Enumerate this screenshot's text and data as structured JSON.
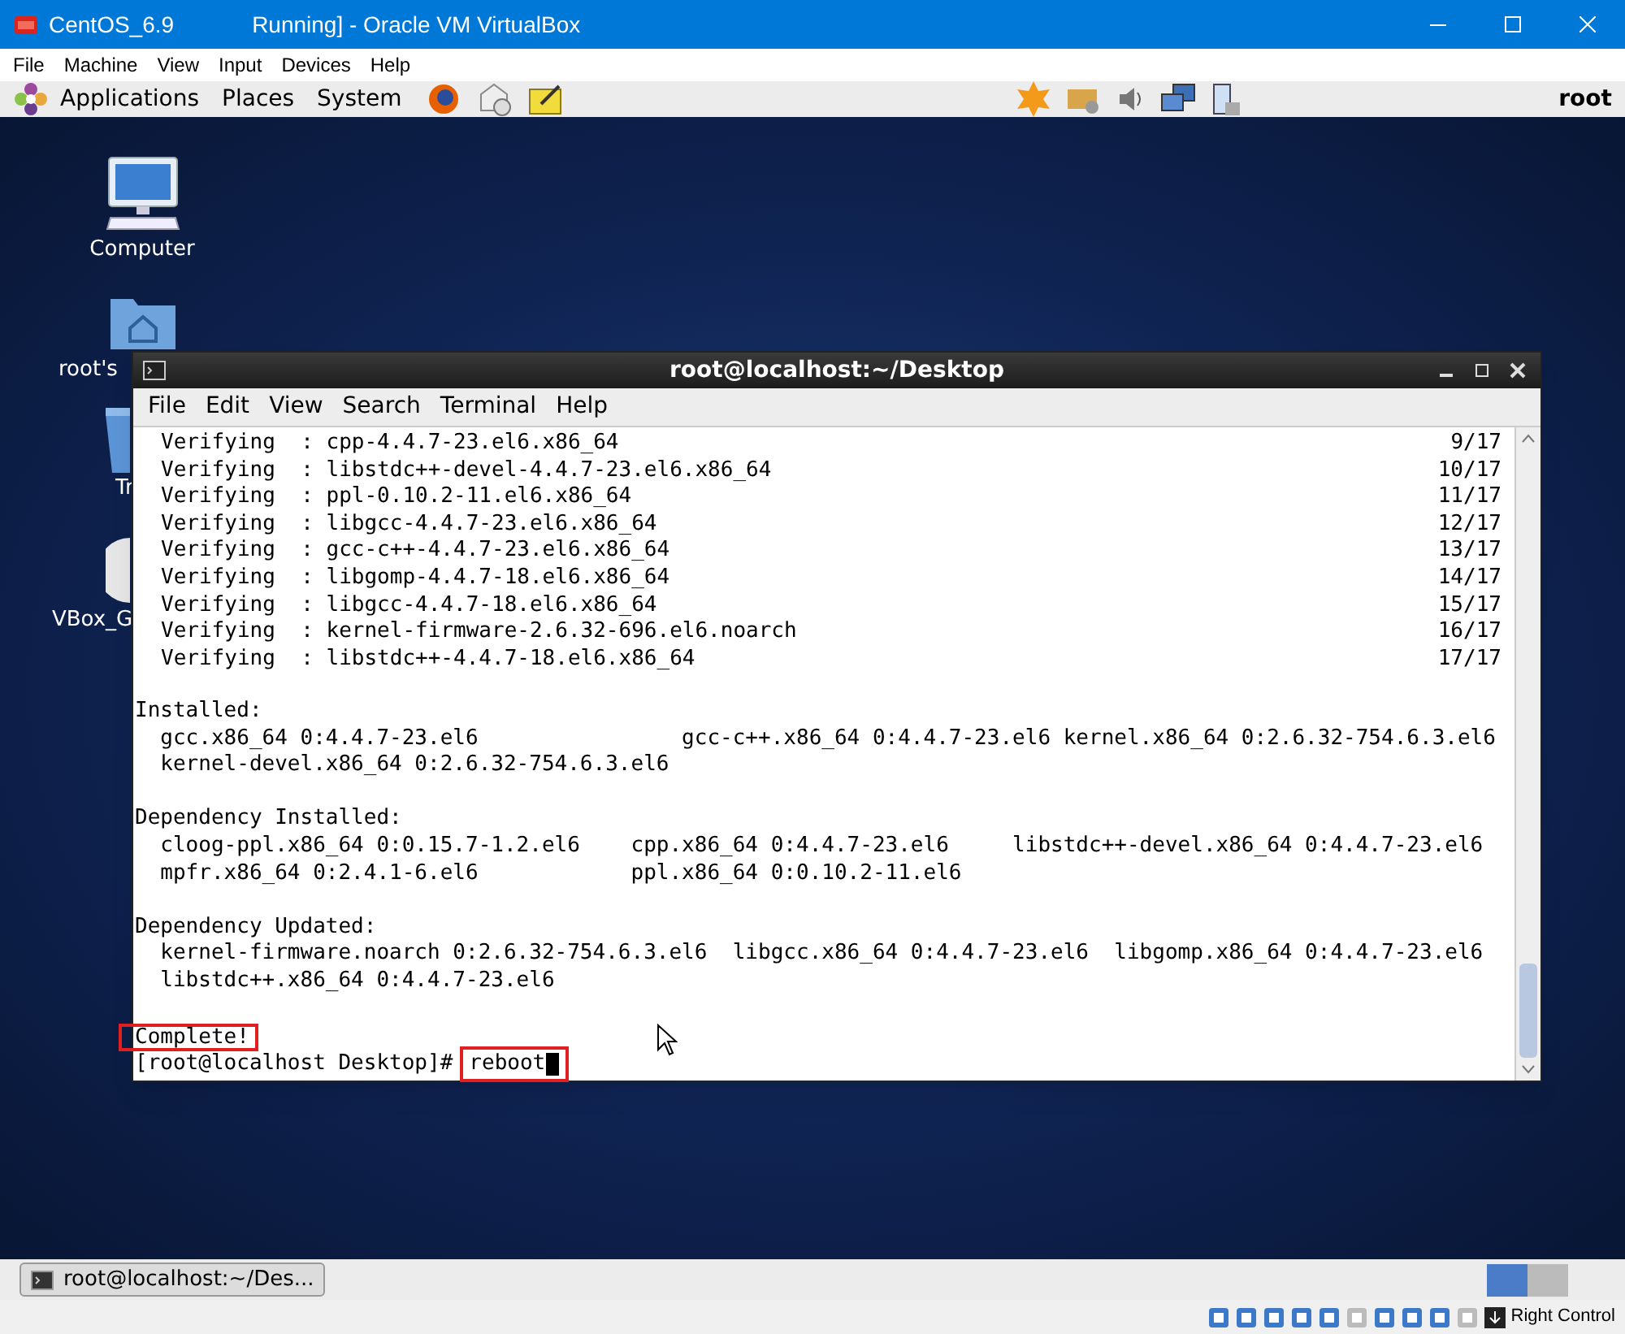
{
  "host_window": {
    "title_start": "CentOS_6.9",
    "title_end": "Running] - Oracle VM VirtualBox",
    "menu": [
      "File",
      "Machine",
      "View",
      "Input",
      "Devices",
      "Help"
    ]
  },
  "guest_panel": {
    "menus": [
      "Applications",
      "Places",
      "System"
    ],
    "user": "root"
  },
  "desktop_icons": [
    {
      "kind": "computer",
      "label": "Computer"
    },
    {
      "kind": "home",
      "label": "root's"
    },
    {
      "kind": "trash",
      "label": "Tr"
    },
    {
      "kind": "disc",
      "label": "VBox_G"
    }
  ],
  "terminal": {
    "title": "root@localhost:~/Desktop",
    "menu": [
      "File",
      "Edit",
      "View",
      "Search",
      "Terminal",
      "Help"
    ],
    "lines": [
      {
        "kind": "verify",
        "text": "Verifying  : cpp-4.4.7-23.el6.x86_64",
        "count": "9/17"
      },
      {
        "kind": "verify",
        "text": "Verifying  : libstdc++-devel-4.4.7-23.el6.x86_64",
        "count": "10/17"
      },
      {
        "kind": "verify",
        "text": "Verifying  : ppl-0.10.2-11.el6.x86_64",
        "count": "11/17"
      },
      {
        "kind": "verify",
        "text": "Verifying  : libgcc-4.4.7-23.el6.x86_64",
        "count": "12/17"
      },
      {
        "kind": "verify",
        "text": "Verifying  : gcc-c++-4.4.7-23.el6.x86_64",
        "count": "13/17"
      },
      {
        "kind": "verify",
        "text": "Verifying  : libgomp-4.4.7-18.el6.x86_64",
        "count": "14/17"
      },
      {
        "kind": "verify",
        "text": "Verifying  : libgcc-4.4.7-18.el6.x86_64",
        "count": "15/17"
      },
      {
        "kind": "verify",
        "text": "Verifying  : kernel-firmware-2.6.32-696.el6.noarch",
        "count": "16/17"
      },
      {
        "kind": "verify",
        "text": "Verifying  : libstdc++-4.4.7-18.el6.x86_64",
        "count": "17/17"
      },
      {
        "kind": "blank"
      },
      {
        "kind": "text",
        "text": "Installed:",
        "highlighted": false
      },
      {
        "kind": "text",
        "text": "  gcc.x86_64 0:4.4.7-23.el6                gcc-c++.x86_64 0:4.4.7-23.el6 kernel.x86_64 0:2.6.32-754.6.3.el6",
        "highlighted": false
      },
      {
        "kind": "text",
        "text": "  kernel-devel.x86_64 0:2.6.32-754.6.3.el6",
        "highlighted": false
      },
      {
        "kind": "blank"
      },
      {
        "kind": "text",
        "text": "Dependency Installed:",
        "highlighted": false
      },
      {
        "kind": "text",
        "text": "  cloog-ppl.x86_64 0:0.15.7-1.2.el6    cpp.x86_64 0:4.4.7-23.el6     libstdc++-devel.x86_64 0:4.4.7-23.el6",
        "highlighted": false
      },
      {
        "kind": "text",
        "text": "  mpfr.x86_64 0:2.4.1-6.el6            ppl.x86_64 0:0.10.2-11.el6",
        "highlighted": false
      },
      {
        "kind": "blank"
      },
      {
        "kind": "text",
        "text": "Dependency Updated:",
        "highlighted": false
      },
      {
        "kind": "text",
        "text": "  kernel-firmware.noarch 0:2.6.32-754.6.3.el6  libgcc.x86_64 0:4.4.7-23.el6  libgomp.x86_64 0:4.4.7-23.el6",
        "highlighted": false
      },
      {
        "kind": "text",
        "text": "  libstdc++.x86_64 0:4.4.7-23.el6",
        "highlighted": false
      },
      {
        "kind": "blank"
      },
      {
        "kind": "text",
        "text": "Complete!",
        "highlighted": true
      },
      {
        "kind": "prompt",
        "prompt": "[root@localhost Desktop]#",
        "command": "reboot",
        "highlighted": true
      }
    ]
  },
  "taskbar": {
    "window_button": "root@localhost:~/Des..."
  },
  "status_bar": {
    "host_key": "Right Control"
  }
}
